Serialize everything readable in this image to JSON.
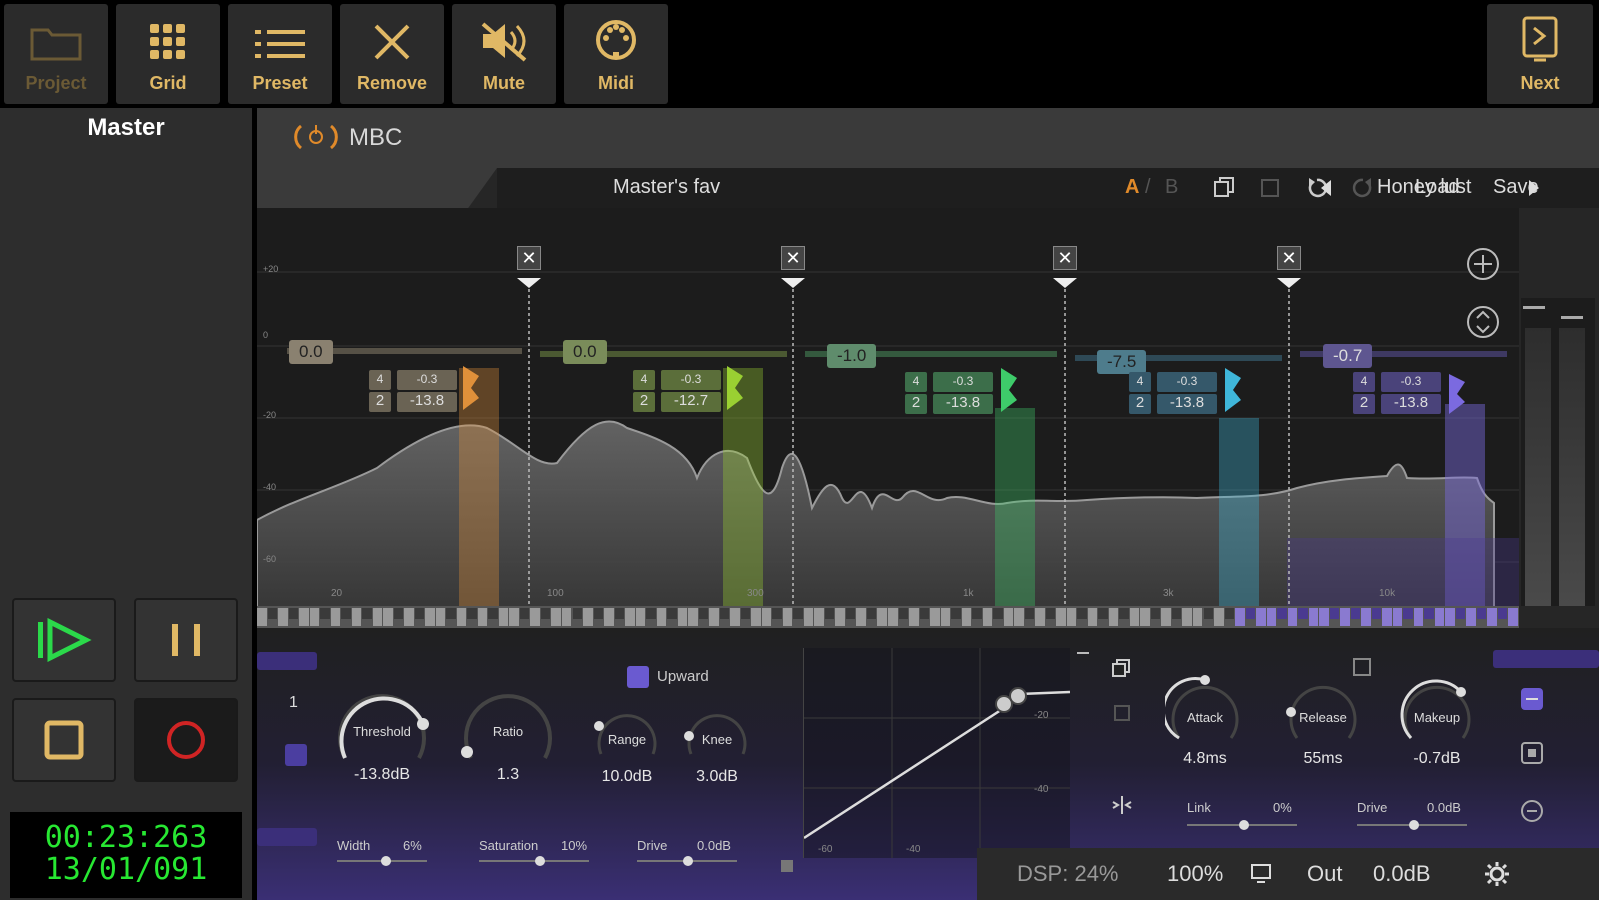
{
  "toolbar": {
    "buttons": [
      {
        "label": "Project",
        "icon": "folder-icon"
      },
      {
        "label": "Grid",
        "icon": "grid-icon"
      },
      {
        "label": "Preset",
        "icon": "list-icon"
      },
      {
        "label": "Remove",
        "icon": "close-icon"
      },
      {
        "label": "Mute",
        "icon": "speaker-mute-icon"
      },
      {
        "label": "Midi",
        "icon": "midi-icon"
      }
    ],
    "next_label": "Next"
  },
  "left": {
    "title": "Master",
    "transport": {
      "play": "play-icon",
      "pause": "pause-icon",
      "stop": "stop-icon",
      "record": "record-icon"
    },
    "clock_time": "00:23:263",
    "clock_bars": "13/01/091"
  },
  "plugin": {
    "name": "MBC",
    "preset_name": "Master's fav",
    "ab_a": "A",
    "ab_sep": "/",
    "ab_b": "B",
    "load": "Load",
    "save": "Save",
    "preset_nav": "Honey lust"
  },
  "analyzer": {
    "y_labels": [
      "+20",
      "0",
      "-20",
      "-40",
      "-60"
    ],
    "x_labels": [
      "20",
      "100",
      "300",
      "1k",
      "3k",
      "10k"
    ],
    "bands": [
      {
        "gain": "0.0",
        "q": "4",
        "ratio": "2",
        "range": "-0.3",
        "thresh": "-13.8",
        "color": "#e0903a"
      },
      {
        "gain": "0.0",
        "q": "4",
        "ratio": "2",
        "range": "-0.3",
        "thresh": "-12.7",
        "color": "#9ad032"
      },
      {
        "gain": "-1.0",
        "q": "4",
        "ratio": "2",
        "range": "-0.3",
        "thresh": "-13.8",
        "color": "#3ecb6a"
      },
      {
        "gain": "-7.5",
        "q": "4",
        "ratio": "2",
        "range": "-0.3",
        "thresh": "-13.8",
        "color": "#3fb6d9"
      },
      {
        "gain": "-0.7",
        "q": "4",
        "ratio": "2",
        "range": "-0.3",
        "thresh": "-13.8",
        "color": "#7b6ae0"
      }
    ]
  },
  "controls": {
    "band_number": "1",
    "upward_label": "Upward",
    "knobs": [
      {
        "label": "Threshold",
        "value": "-13.8dB"
      },
      {
        "label": "Ratio",
        "value": "1.3"
      },
      {
        "label": "Range",
        "value": "10.0dB"
      },
      {
        "label": "Knee",
        "value": "3.0dB"
      },
      {
        "label": "Attack",
        "value": "4.8ms"
      },
      {
        "label": "Release",
        "value": "55ms"
      },
      {
        "label": "Makeup",
        "value": "-0.7dB"
      }
    ],
    "sliders": [
      {
        "label": "Width",
        "value": "6%"
      },
      {
        "label": "Saturation",
        "value": "10%"
      },
      {
        "label": "Drive",
        "value": "0.0dB"
      },
      {
        "label": "Link",
        "value": "0%"
      },
      {
        "label": "Drive",
        "value": "0.0dB"
      }
    ],
    "curve_y_labels": [
      "-20",
      "-40"
    ],
    "curve_x_labels": [
      "-60",
      "-40"
    ]
  },
  "status": {
    "dsp": "DSP: 24%",
    "zoom": "100%",
    "out_label": "Out",
    "out_value": "0.0dB"
  }
}
